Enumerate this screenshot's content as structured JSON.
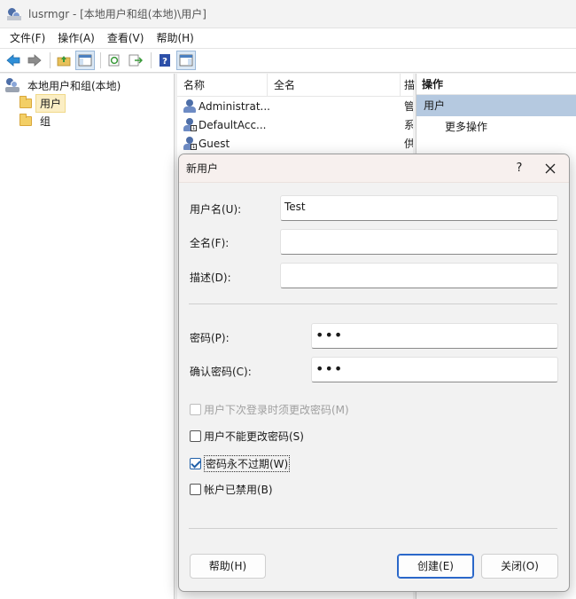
{
  "window": {
    "title": "lusrmgr - [本地用户和组(本地)\\用户]"
  },
  "menu": [
    "文件(F)",
    "操作(A)",
    "查看(V)",
    "帮助(H)"
  ],
  "toolbar": {
    "icons": [
      "back-arrow-icon",
      "forward-arrow-icon",
      "up-folder-icon",
      "show-hide-tree-icon",
      "refresh-icon",
      "export-list-icon",
      "help-icon",
      "show-hide-action-pane-icon"
    ]
  },
  "tree": {
    "root": "本地用户和组(本地)",
    "items": [
      "用户",
      "组"
    ]
  },
  "list": {
    "headers": {
      "name": "名称",
      "fullname": "全名",
      "desc": "描"
    },
    "rows": [
      {
        "name": "Administrat...",
        "desc": "管"
      },
      {
        "name": "DefaultAcc...",
        "desc": "系"
      },
      {
        "name": "Guest",
        "desc": "供"
      }
    ]
  },
  "actions": {
    "header": "操作",
    "section": "用户",
    "more": "更多操作"
  },
  "dialog": {
    "title": "新用户",
    "help": "?",
    "username_label": "用户名(U):",
    "username_value": "Test",
    "fullname_label": "全名(F):",
    "fullname_value": "",
    "desc_label": "描述(D):",
    "desc_value": "",
    "password_label": "密码(P):",
    "password_value": "•••",
    "confirm_label": "确认密码(C):",
    "confirm_value": "•••",
    "checks": [
      {
        "label": "用户下次登录时须更改密码(M)",
        "checked": false,
        "disabled": true
      },
      {
        "label": "用户不能更改密码(S)",
        "checked": false,
        "disabled": false
      },
      {
        "label": "密码永不过期(W)",
        "checked": true,
        "disabled": false
      },
      {
        "label": "帐户已禁用(B)",
        "checked": false,
        "disabled": false
      }
    ],
    "buttons": {
      "help": "帮助(H)",
      "create": "创建(E)",
      "close": "关闭(O)"
    }
  }
}
